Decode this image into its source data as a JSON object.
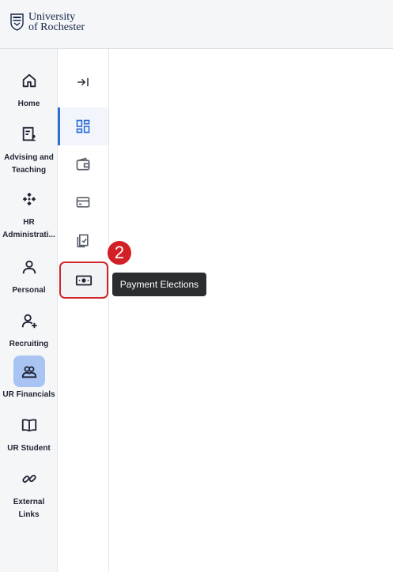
{
  "brand": {
    "line1": "University",
    "line2": "of Rochester"
  },
  "nav": [
    {
      "label": "Home",
      "icon": "home-icon"
    },
    {
      "label": "Advising and Teaching",
      "icon": "document-person-icon"
    },
    {
      "label": "HR Administrati...",
      "icon": "diamond-grid-icon"
    },
    {
      "label": "Personal",
      "icon": "person-icon"
    },
    {
      "label": "Recruiting",
      "icon": "person-add-icon"
    },
    {
      "label": "UR Financials",
      "icon": "people-group-icon",
      "active": true
    },
    {
      "label": "UR Student",
      "icon": "book-icon"
    },
    {
      "label": "External Links",
      "icon": "link-icon"
    }
  ],
  "annotation": {
    "step": "2",
    "tooltip": "Payment Elections"
  },
  "colors": {
    "accent": "#2f6fd6",
    "active_bg": "#a9c4f3",
    "highlight": "#d0262b"
  }
}
